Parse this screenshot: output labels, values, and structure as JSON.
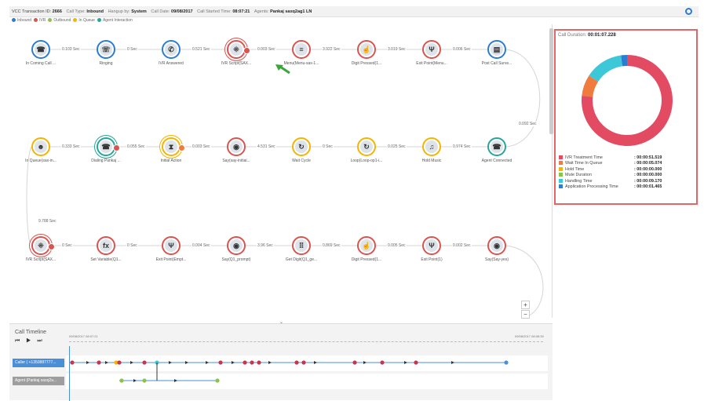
{
  "header": {
    "transaction_label": "VCC Transaction ID:",
    "transaction_id": "2666",
    "call_type_label": "Call Type:",
    "call_type": "Inbound",
    "hangup_label": "Hangup by:",
    "hangup": "System",
    "call_date_label": "Call Date:",
    "call_date": "09/08/2017",
    "call_started_label": "Call Started Time:",
    "call_started": "08:07:21",
    "agents_label": "Agents:",
    "agents": "Pankaj saxq2ag1 LN"
  },
  "legend": [
    {
      "label": "Inbound",
      "color": "#2b7cd3"
    },
    {
      "label": "IVR",
      "color": "#d9534f"
    },
    {
      "label": "Outbound",
      "color": "#8bc34a"
    },
    {
      "label": "In Queue",
      "color": "#f4b400"
    },
    {
      "label": "Agent Interaction",
      "color": "#26a69a"
    }
  ],
  "flow": {
    "row1": {
      "nodes": [
        {
          "label": "In Coming Call ...",
          "icon": "phone-incoming-icon",
          "glyph": "☎",
          "ring": "blue"
        },
        {
          "label": "Ringing",
          "icon": "ringing-phone-icon",
          "glyph": "☏",
          "ring": "blue"
        },
        {
          "label": "IVR Answered",
          "icon": "phone-answered-icon",
          "glyph": "✆",
          "ring": "blue"
        },
        {
          "label": "IVR Script(SAX...",
          "icon": "ivr-script-icon",
          "glyph": "⁜",
          "ring": "red"
        },
        {
          "label": "Menu(Menu-sax-1...",
          "icon": "menu-icon",
          "glyph": "≡",
          "ring": "red"
        },
        {
          "label": "Digit Pressed(1...",
          "icon": "keypad-hand-icon",
          "glyph": "☝",
          "ring": "red"
        },
        {
          "label": "Exit Point(Menu...",
          "icon": "exit-point-icon",
          "glyph": "Ψ",
          "ring": "red"
        },
        {
          "label": "Post Call Surve...",
          "icon": "survey-icon",
          "glyph": "▤",
          "ring": "blue"
        }
      ],
      "durations": [
        "0.103 Sec",
        "0 Sec",
        "0.521 Sec",
        "0.003 Sec",
        "3.922 Sec",
        "3.019 Sec",
        "0.006 Sec"
      ]
    },
    "wrap1": "0.092 Sec",
    "row2": {
      "nodes": [
        {
          "label": "In Queue(sax-in...",
          "icon": "queue-people-icon",
          "glyph": "☻",
          "ring": "yellow"
        },
        {
          "label": "Dialing Pankaj ...",
          "icon": "dialing-icon",
          "glyph": "☎",
          "ring": "green"
        },
        {
          "label": "Initial Action",
          "icon": "hourglass-icon",
          "glyph": "⧗",
          "ring": "yellow"
        },
        {
          "label": "Say(say-initial...",
          "icon": "speech-icon",
          "glyph": "◉",
          "ring": "red"
        },
        {
          "label": "Wait Cycle",
          "icon": "wait-cycle-icon",
          "glyph": "↻",
          "ring": "yellow"
        },
        {
          "label": "Loop(Loop-op1-i...",
          "icon": "loop-icon",
          "glyph": "↻",
          "ring": "yellow"
        },
        {
          "label": "Hold Music",
          "icon": "music-icon",
          "glyph": "♫",
          "ring": "yellow"
        },
        {
          "label": "Agent Connected",
          "icon": "agent-connected-icon",
          "glyph": "☎",
          "ring": "green"
        }
      ],
      "durations": [
        "0.333 Sec",
        "0.055 Sec",
        "0.003 Sec",
        "4.531 Sec",
        "0 Sec",
        "0.025 Sec",
        "0.974 Sec"
      ]
    },
    "wrap2": "9.788 Sec",
    "row3": {
      "nodes": [
        {
          "label": "IVR Script(SAX...",
          "icon": "ivr-script-icon",
          "glyph": "⁜",
          "ring": "red"
        },
        {
          "label": "Set Variable(Q1...",
          "icon": "function-icon",
          "glyph": "fx",
          "ring": "red"
        },
        {
          "label": "Exit Point(Empt...",
          "icon": "exit-point-icon",
          "glyph": "Ψ",
          "ring": "red"
        },
        {
          "label": "Say(Q1_prompt)",
          "icon": "speech-icon",
          "glyph": "◉",
          "ring": "red"
        },
        {
          "label": "Get Digit(Q1_ge...",
          "icon": "keypad-icon",
          "glyph": "⠿",
          "ring": "red"
        },
        {
          "label": "Digit Pressed(1...",
          "icon": "keypad-hand-icon",
          "glyph": "☝",
          "ring": "red"
        },
        {
          "label": "Exit Point(1)",
          "icon": "exit-point-icon",
          "glyph": "Ψ",
          "ring": "red"
        },
        {
          "label": "Say(Say-yes)",
          "icon": "speech-icon",
          "glyph": "◉",
          "ring": "red"
        }
      ],
      "durations": [
        "0 Sec",
        "0 Sec",
        "0.004 Sec",
        "3.96 Sec",
        "0.869 Sec",
        "0.005 Sec",
        "0.002 Sec"
      ]
    },
    "zoom_in": "+",
    "zoom_out": "−"
  },
  "duration_panel": {
    "title_label": "Call Duration:",
    "title_value": "00:01:07.228",
    "items": [
      {
        "label": "IVR Treatment Time",
        "value": ": 00:00:51.519",
        "seconds": 51.519,
        "color": "#e34b63"
      },
      {
        "label": "Wait Time In Queue",
        "value": ": 00:00:05.074",
        "seconds": 5.074,
        "color": "#f07b3f"
      },
      {
        "label": "Hold Time",
        "value": ": 00:00:00.000",
        "seconds": 0,
        "color": "#f4b400"
      },
      {
        "label": "Mute Duration",
        "value": ": 00:00:00.000",
        "seconds": 0,
        "color": "#8bc34a"
      },
      {
        "label": "Handling Time",
        "value": ": 00:00:09.170",
        "seconds": 9.17,
        "color": "#3cc8d8"
      },
      {
        "label": "Application Processing Time",
        "value": ": 00:00:01.465",
        "seconds": 1.465,
        "color": "#2b7cd3"
      }
    ]
  },
  "timeline": {
    "title": "Call Timeline",
    "controls": "⏮ ▶ ⏭",
    "start": "09/08/2017 08:07:21",
    "end": "09/08/2017 08:08:35",
    "caller_label": "Caller ( +1350887777...",
    "agent_label": "Agent (Pankaj saxq2a..."
  }
}
